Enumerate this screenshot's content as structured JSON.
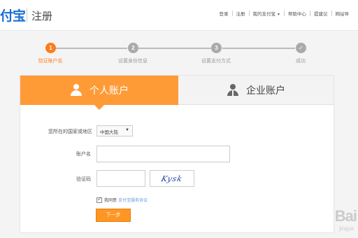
{
  "header": {
    "logo": "付宝",
    "title": "注册",
    "nav": [
      {
        "label": "登录"
      },
      {
        "label": "注册"
      },
      {
        "label": "我的支付宝",
        "has_caret": true
      },
      {
        "label": "帮助中心"
      },
      {
        "label": "提建议"
      },
      {
        "label": "网站导"
      }
    ]
  },
  "steps": [
    {
      "number": "1",
      "label": "验证账户名",
      "active": true
    },
    {
      "number": "2",
      "label": "设置身份信息",
      "active": false
    },
    {
      "number": "3",
      "label": "设置支付方式",
      "active": false
    },
    {
      "number": "✓",
      "label": "成功",
      "active": false
    }
  ],
  "tabs": {
    "personal": "个人账户",
    "company": "企业账户"
  },
  "form": {
    "region_label": "您所在的国家或地区",
    "region_value": "中国大陆",
    "account_label": "账户名",
    "account_value": "",
    "code_label": "验证码",
    "code_value": "",
    "captcha_text": "Kysk",
    "agree_prefix": "我同意",
    "agree_link": "支付宝服务协议",
    "next_label": "下一步"
  },
  "watermark": {
    "main": "Bai",
    "sub": "jingya"
  },
  "colors": {
    "accent": "#ff9b37",
    "step_active": "#ff7b1a",
    "button": "#ff9624",
    "logo": "#1a6fd1"
  }
}
